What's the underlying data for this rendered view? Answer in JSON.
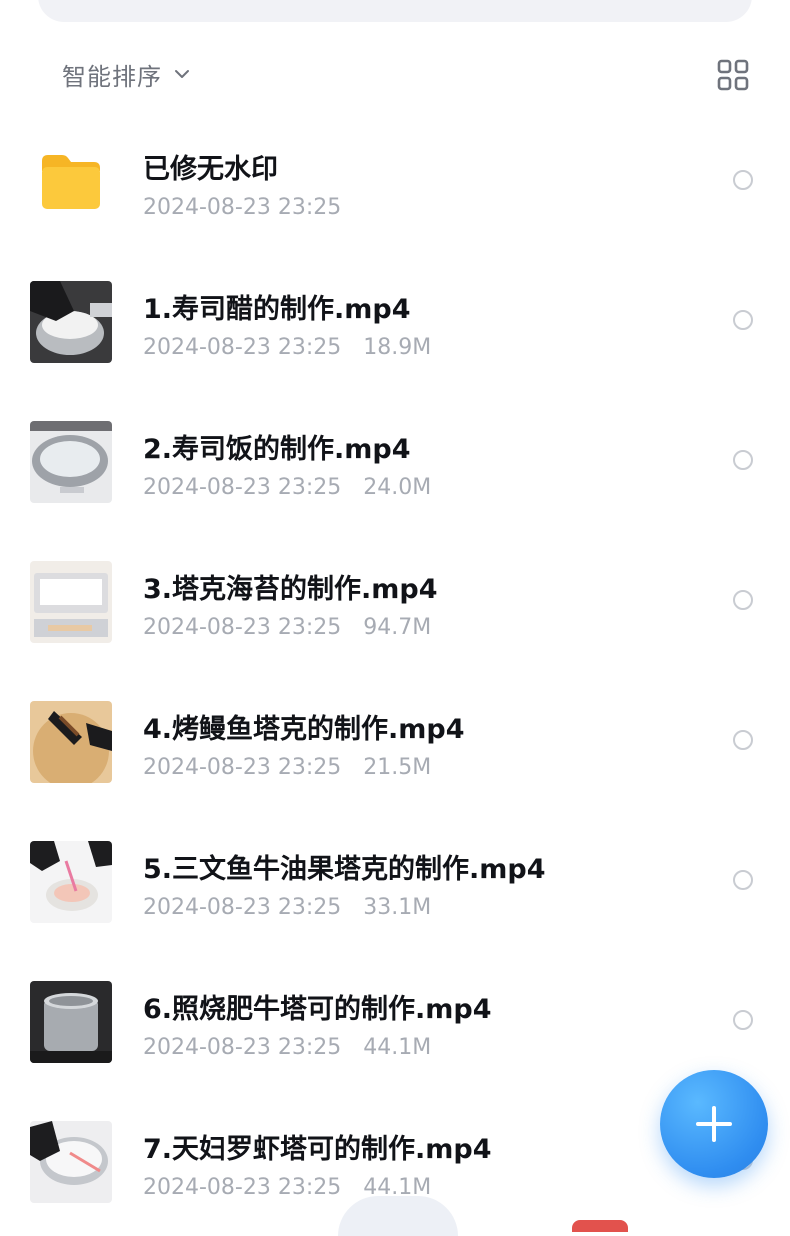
{
  "sort": {
    "label": "智能排序"
  },
  "files": [
    {
      "kind": "folder",
      "name": "已修无水印",
      "date": "2024-08-23 23:25",
      "size": ""
    },
    {
      "kind": "video",
      "name": "1.寿司醋的制作.mp4",
      "date": "2024-08-23 23:25",
      "size": "18.9M"
    },
    {
      "kind": "video",
      "name": "2.寿司饭的制作.mp4",
      "date": "2024-08-23 23:25",
      "size": "24.0M"
    },
    {
      "kind": "video",
      "name": "3.塔克海苔的制作.mp4",
      "date": "2024-08-23 23:25",
      "size": "94.7M"
    },
    {
      "kind": "video",
      "name": "4.烤鳗鱼塔克的制作.mp4",
      "date": "2024-08-23 23:25",
      "size": "21.5M"
    },
    {
      "kind": "video",
      "name": "5.三文鱼牛油果塔克的制作.mp4",
      "date": "2024-08-23 23:25",
      "size": "33.1M"
    },
    {
      "kind": "video",
      "name": "6.照烧肥牛塔可的制作.mp4",
      "date": "2024-08-23 23:25",
      "size": "44.1M"
    },
    {
      "kind": "video",
      "name": "7.天妇罗虾塔可的制作.mp4",
      "date": "2024-08-23 23:25",
      "size": "44.1M"
    }
  ],
  "icons": {
    "folder": "folder-icon",
    "sort_chevron": "chevron-down-icon",
    "grid_toggle": "grid-view-icon",
    "fab": "plus-icon"
  },
  "colors": {
    "accent": "#2f8df0",
    "folder": "#fcc93c",
    "title_text": "#111318",
    "meta_text": "#a7abb3"
  }
}
